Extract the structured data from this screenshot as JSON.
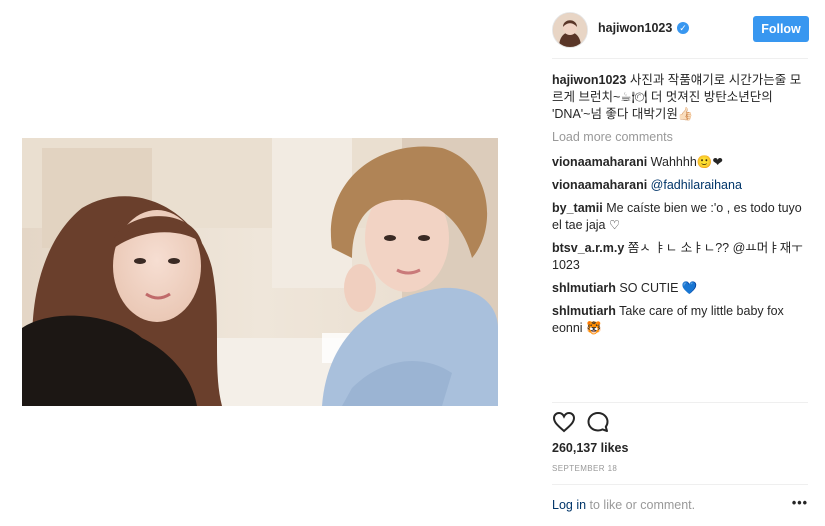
{
  "post": {
    "username": "hajiwon1023",
    "follow_label": "Follow",
    "caption_user": "hajiwon1023",
    "caption_text": "사진과 작품얘기로 시간가는줄 모르게 브런치~☕🍽 더 멋져진 방탄소년단의 'DNA'~넘 좋다 대박기원👍🏻",
    "load_more": "Load more comments",
    "comments": [
      {
        "user": "vionaamaharani",
        "text": "Wahhhh🙂❤"
      },
      {
        "user": "vionaamaharani",
        "text": "@fadhilaraihana"
      },
      {
        "user": "by_tamii",
        "text": "Me caíste bien we :'o , es todo tuyo el tae jaja ♡"
      },
      {
        "user": "btsv_a.r.m.y",
        "text": "쫌ㅅ ㅑㄴ 소ㅑㄴ?? @ㅛ머ㅑ재ㅜ1023"
      },
      {
        "user": "shlmutiarh",
        "text": "SO CUTIE 💙"
      },
      {
        "user": "shlmutiarh",
        "text": "Take care of my little baby fox eonni 🐯"
      }
    ],
    "likes": "260,137 likes",
    "date": "SEPTEMBER 18",
    "login_link": "Log in",
    "login_rest": " to like or comment.",
    "more_label": "•••",
    "accent": "#3897f0"
  }
}
